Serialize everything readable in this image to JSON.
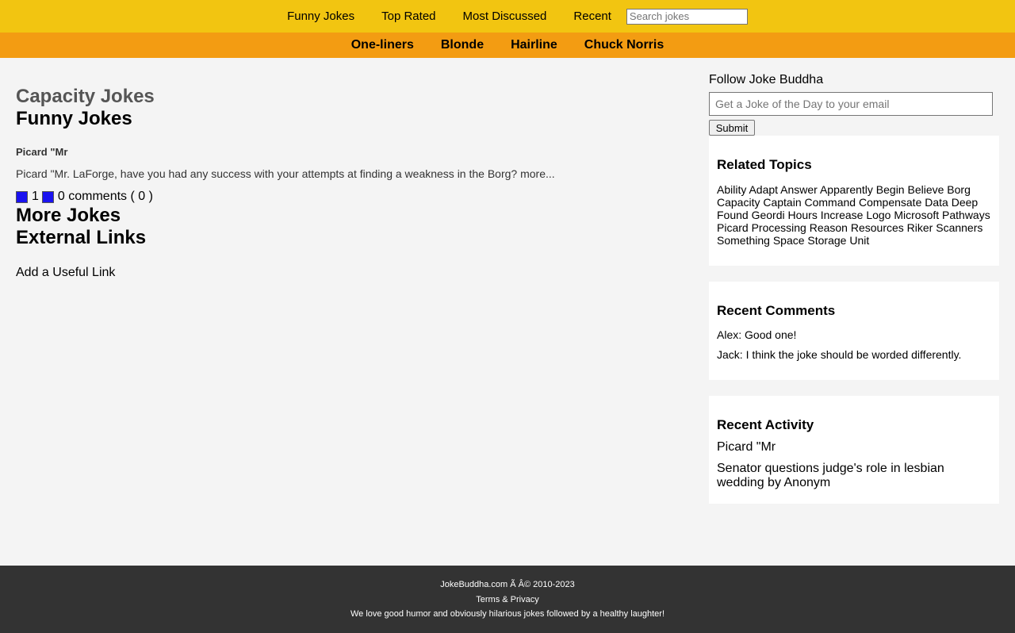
{
  "topnav": {
    "links": [
      "Funny Jokes",
      "Top Rated",
      "Most Discussed",
      "Recent"
    ],
    "search_placeholder": "Search jokes"
  },
  "subnav": {
    "links": [
      "One-liners",
      "Blonde",
      "Hairline",
      "Chuck Norris"
    ]
  },
  "main": {
    "page_title": "Capacity Jokes",
    "funny_heading": "Funny Jokes",
    "joke": {
      "title": "Picard \"Mr",
      "text": "Picard \"Mr. LaForge, have you had any success with your attempts at finding a weakness in the Borg? more...",
      "votes": "1",
      "comments": "0 comments ( 0 )"
    },
    "more_heading": "More Jokes",
    "external_heading": "External Links",
    "add_link": "Add a Useful Link"
  },
  "sidebar": {
    "follow_label": "Follow Joke Buddha",
    "email_placeholder": "Get a Joke of the Day to your email",
    "submit_label": "Submit",
    "related_heading": "Related Topics",
    "related_topics": "Ability Adapt Answer Apparently Begin Believe Borg Capacity Captain Command Compensate Data Deep Found Geordi Hours Increase Logo Microsoft Pathways Picard Processing Reason Resources Riker Scanners Something Space Storage Unit",
    "comments_heading": "Recent Comments",
    "comments": [
      "Alex: Good one!",
      "Jack: I think the joke should be worded differently."
    ],
    "activity_heading": "Recent Activity",
    "activity": [
      "Picard \"Mr",
      "Senator questions judge's role in lesbian wedding by Anonym"
    ]
  },
  "footer": {
    "copyright": "JokeBuddha.com Ã   Â© 2010-2023",
    "terms": "Terms & Privacy",
    "tagline": "We love good humor and obviously hilarious jokes followed by a healthy laughter!"
  },
  "colors": {
    "topnav_bg": "#f2c511",
    "subnav_bg": "#f39c12",
    "footer_bg": "#333333",
    "vote_square": "#1a12f0"
  }
}
